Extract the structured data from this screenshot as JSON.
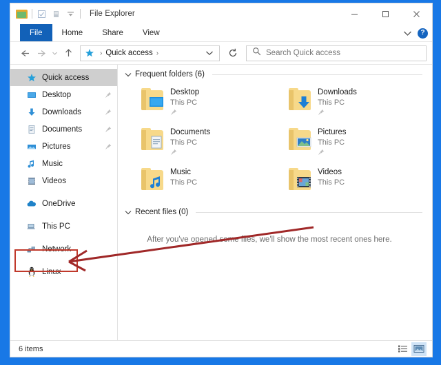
{
  "window": {
    "title": "File Explorer",
    "accent_color": "#1878e6",
    "controls": {
      "minimize": "Minimize",
      "maximize": "Maximize",
      "close": "Close"
    },
    "quick_access_toolbar": [
      {
        "name": "properties-icon",
        "label": "Properties"
      },
      {
        "name": "new-folder-icon",
        "label": "New folder"
      },
      {
        "name": "customize-dropdown-icon",
        "label": "Customize Quick Access Toolbar"
      }
    ]
  },
  "ribbon": {
    "tabs": [
      {
        "label": "File",
        "active": true
      },
      {
        "label": "Home",
        "active": false
      },
      {
        "label": "Share",
        "active": false
      },
      {
        "label": "View",
        "active": false
      }
    ],
    "collapse_label": "Minimize the Ribbon",
    "help_label": "?"
  },
  "navigation": {
    "back_label": "Back",
    "forward_label": "Forward",
    "recent_label": "Recent locations",
    "up_label": "Up",
    "breadcrumb": {
      "icon": "quick-access-star-icon",
      "path": "Quick access",
      "separator": "›",
      "trailing_separator": "›"
    },
    "dropdown_label": "Previous locations",
    "refresh_label": "Refresh"
  },
  "search": {
    "placeholder": "Search Quick access",
    "value": ""
  },
  "sidebar": {
    "items": [
      {
        "label": "Quick access",
        "icon": "star-icon",
        "selected": true,
        "pinned": false,
        "group_gap": false
      },
      {
        "label": "Desktop",
        "icon": "monitor-icon",
        "selected": false,
        "pinned": true,
        "group_gap": false
      },
      {
        "label": "Downloads",
        "icon": "download-arrow-icon",
        "selected": false,
        "pinned": true,
        "group_gap": false
      },
      {
        "label": "Documents",
        "icon": "document-icon",
        "selected": false,
        "pinned": true,
        "group_gap": false
      },
      {
        "label": "Pictures",
        "icon": "picture-icon",
        "selected": false,
        "pinned": true,
        "group_gap": false
      },
      {
        "label": "Music",
        "icon": "music-note-icon",
        "selected": false,
        "pinned": false,
        "group_gap": false
      },
      {
        "label": "Videos",
        "icon": "film-icon",
        "selected": false,
        "pinned": false,
        "group_gap": false
      },
      {
        "label": "OneDrive",
        "icon": "cloud-icon",
        "selected": false,
        "pinned": false,
        "group_gap": true
      },
      {
        "label": "This PC",
        "icon": "computer-icon",
        "selected": false,
        "pinned": false,
        "group_gap": true
      },
      {
        "label": "Network",
        "icon": "network-icon",
        "selected": false,
        "pinned": false,
        "group_gap": true
      },
      {
        "label": "Linux",
        "icon": "penguin-icon",
        "selected": false,
        "pinned": false,
        "group_gap": true,
        "highlighted": true
      }
    ]
  },
  "main": {
    "frequent_folders": {
      "title": "Frequent folders (6)",
      "collapsed": false,
      "items": [
        {
          "name": "Desktop",
          "location": "This PC",
          "badge": "monitor-badge",
          "pinned": true
        },
        {
          "name": "Downloads",
          "location": "This PC",
          "badge": "download-badge",
          "pinned": true
        },
        {
          "name": "Documents",
          "location": "This PC",
          "badge": "document-badge",
          "pinned": true
        },
        {
          "name": "Pictures",
          "location": "This PC",
          "badge": "picture-badge",
          "pinned": true
        },
        {
          "name": "Music",
          "location": "This PC",
          "badge": "music-badge",
          "pinned": false
        },
        {
          "name": "Videos",
          "location": "This PC",
          "badge": "film-badge",
          "pinned": false
        }
      ]
    },
    "recent_files": {
      "title": "Recent files (0)",
      "collapsed": false,
      "empty_message": "After you've opened some files, we'll show the most recent ones here."
    }
  },
  "annotation": {
    "color": "#a02828",
    "box_target": "Linux",
    "arrow_label": "pointer-to-linux"
  },
  "statusbar": {
    "item_count": "6 items",
    "views": [
      {
        "name": "details-view",
        "label": "Details view",
        "active": false
      },
      {
        "name": "large-icons-view",
        "label": "Large icons view",
        "active": true
      }
    ]
  }
}
